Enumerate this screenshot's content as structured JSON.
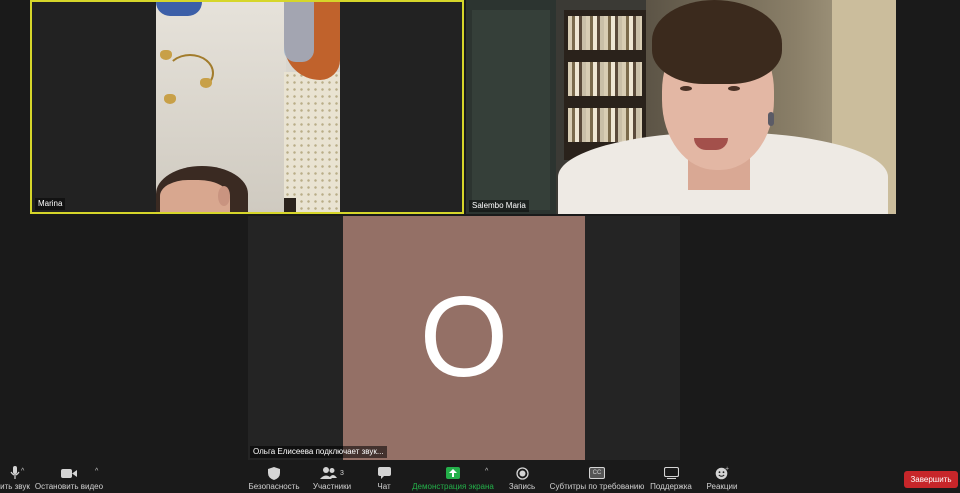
{
  "participants": [
    {
      "name": "Marina"
    },
    {
      "name": "Salembo Maria"
    }
  ],
  "joining": {
    "avatar_letter": "O",
    "status": "Ольга Елисеева подключает звук...",
    "avatar_color": "#947066"
  },
  "active_speaker_border": "#d6d62a",
  "toolbar": {
    "mute": {
      "label": "ить звук",
      "icon": "microphone-icon"
    },
    "video": {
      "label": "Остановить видео",
      "icon": "video-camera-icon"
    },
    "security": {
      "label": "Безопасность",
      "icon": "shield-icon"
    },
    "participants": {
      "label": "Участники",
      "count": "3",
      "icon": "participants-icon"
    },
    "chat": {
      "label": "Чат",
      "icon": "chat-icon"
    },
    "share": {
      "label": "Демонстрация экрана",
      "icon": "share-screen-icon",
      "color": "#24b04a"
    },
    "record": {
      "label": "Запись",
      "icon": "record-icon"
    },
    "captions": {
      "label": "Субтитры по требованию",
      "icon": "cc-icon",
      "icon_text": "CC"
    },
    "support": {
      "label": "Поддержка",
      "icon": "support-icon"
    },
    "reactions": {
      "label": "Реакции",
      "icon": "emoji-icon"
    },
    "end": {
      "label": "Завершить",
      "color": "#c7262a"
    }
  }
}
